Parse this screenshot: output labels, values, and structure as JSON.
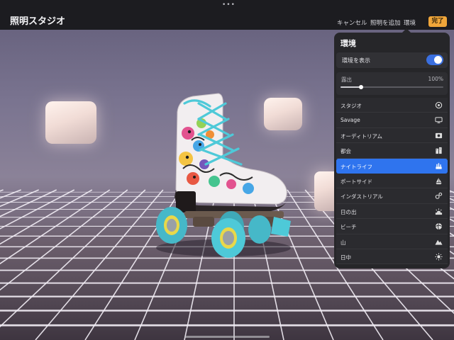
{
  "app": {
    "grabber": "•••",
    "title": "照明スタジオ"
  },
  "toolbar": {
    "cancel_label": "キャンセル",
    "add_light_label": "照明を追加",
    "environment_label": "環境",
    "done_label": "完了"
  },
  "panel": {
    "title": "環境",
    "show_environment": {
      "label": "環境を表示",
      "on": true
    },
    "exposure": {
      "label": "露出",
      "value": "100%",
      "fraction": 0.2
    },
    "environments": [
      {
        "label": "スタジオ",
        "icon": "studio-icon",
        "selected": false
      },
      {
        "label": "Savage",
        "icon": "monitor-icon",
        "selected": false
      },
      {
        "label": "オーディトリアム",
        "icon": "auditorium-icon",
        "selected": false
      },
      {
        "label": "都会",
        "icon": "city-icon",
        "selected": false
      },
      {
        "label": "ナイトライフ",
        "icon": "nightlife-icon",
        "selected": true
      },
      {
        "label": "ポートサイド",
        "icon": "sailboat-icon",
        "selected": false
      },
      {
        "label": "インダストリアル",
        "icon": "industrial-icon",
        "selected": false
      },
      {
        "label": "日の出",
        "icon": "sunrise-icon",
        "selected": false
      },
      {
        "label": "ビーチ",
        "icon": "beach-ball-icon",
        "selected": false
      },
      {
        "label": "山",
        "icon": "mountain-icon",
        "selected": false
      },
      {
        "label": "日中",
        "icon": "sun-icon",
        "selected": false
      }
    ]
  },
  "colors": {
    "accent": "#2f74ee",
    "done_button": "#f0a63a",
    "toggle_on": "#3a6fe0",
    "skate_wheels": "#4ec9d8"
  }
}
